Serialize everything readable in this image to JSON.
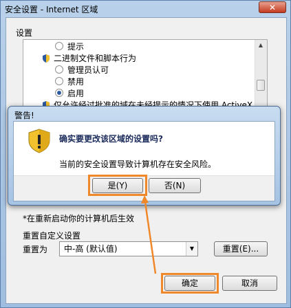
{
  "window": {
    "title": "安全设置 - Internet 区域",
    "close_label": "✕"
  },
  "settings": {
    "group_label": "设置",
    "items": [
      {
        "type": "radio",
        "label": "提示",
        "checked": false
      },
      {
        "type": "header",
        "label": "二进制文件和脚本行为"
      },
      {
        "type": "radio",
        "label": "管理员认可",
        "checked": false
      },
      {
        "type": "radio",
        "label": "禁用",
        "checked": false
      },
      {
        "type": "radio",
        "label": "启用",
        "checked": true
      },
      {
        "type": "header",
        "label": "仅允许经过批准的域在未经提示的情况下使用 ActiveX"
      }
    ]
  },
  "note": "*在重新启动你的计算机后生效",
  "reset": {
    "group_label": "重置自定义设置",
    "label": "重置为",
    "selected": "中-高 (默认值)",
    "button": "重置(E)..."
  },
  "footer": {
    "ok": "确定",
    "cancel": "取消"
  },
  "dialog": {
    "title": "警告!",
    "heading": "确实要更改该区域的设置吗?",
    "message": "当前的安全设置导致计算机存在安全风险。",
    "yes": "是(Y)",
    "no": "否(N)"
  },
  "colors": {
    "highlight": "#f0882a",
    "shield_blue": "#2c5aa0",
    "warning_yellow": "#f2c12e"
  }
}
